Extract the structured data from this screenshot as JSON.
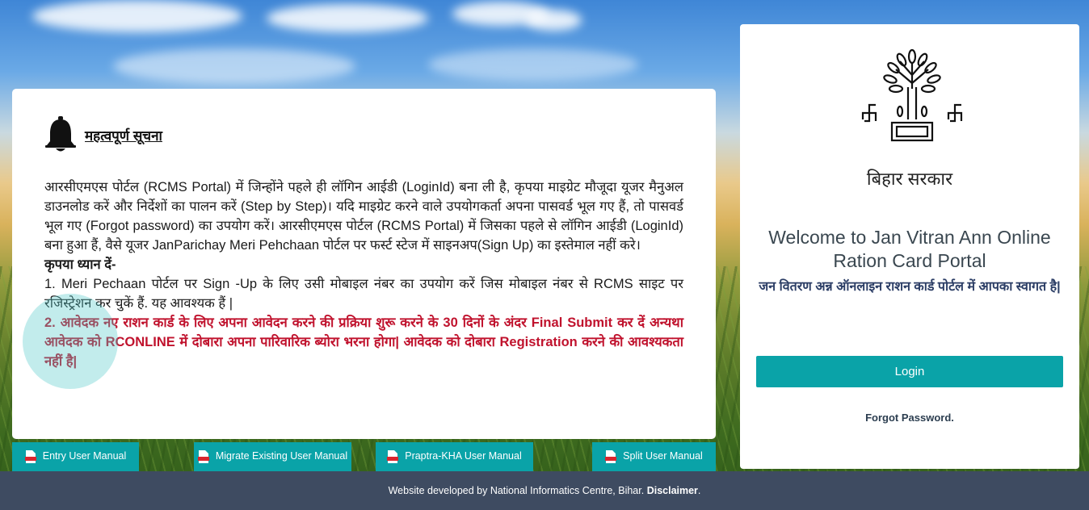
{
  "notice": {
    "title": "महत्वपूर्ण सूचना",
    "para1": "आरसीएमएस पोर्टल (RCMS Portal) में जिन्होंने पहले ही लॉगिन आईडी (LoginId) बना ली है, कृपया माइग्रेट मौजूदा यूजर मैनुअल डाउनलोड करें और निर्देशों का पालन करें (Step by Step)। यदि माइग्रेट करने वाले उपयोगकर्ता अपना पासवर्ड भूल गए हैं, तो पासवर्ड भूल गए (Forgot password) का उपयोग करें। आरसीएमएस पोर्टल (RCMS Portal) में जिसका पहले से लॉगिन आईडी (LoginId) बना हुआ हैं, वैसे यूजर JanParichay Meri Pehchaan पोर्टल पर फर्स्ट स्टेज में साइनअप(Sign Up) का इस्तेमाल नहीं करे।",
    "attention_label": "कृपया ध्यान दें-",
    "point1": "1. Meri Pechaan पोर्टल पर Sign -Up के लिए उसी मोबाइल नंबर का उपयोग करें जिस मोबाइल नंबर से RCMS साइट पर रजिस्ट्रेशन कर चुकें हैं. यह आवश्यक हैं |",
    "point2": "2. आवेदक नए राशन कार्ड के लिए अपना आवेदन करने की प्रक्रिया शुरू करने के 30 दिनों के अंदर Final Submit कर दें अन्यथा आवेदक को RCONLINE में दोबारा अपना पारिवारिक ब्योरा भरना होगा| आवेदक को दोबारा Registration करने की आवश्यकता नहीं है|"
  },
  "manuals": [
    {
      "label": "Entry User Manual"
    },
    {
      "label": "Migrate Existing User Manual"
    },
    {
      "label": "Praptra-KHA User Manual"
    },
    {
      "label": "Split User Manual"
    }
  ],
  "login": {
    "emblem_caption": "बिहार सरकार",
    "welcome_en": "Welcome to Jan Vitran Ann Online Ration Card Portal",
    "welcome_hi": "जन वितरण अन्न ऑनलाइन राशन कार्ड पोर्टल में आपका स्वागत है|",
    "login_button": "Login",
    "forgot_password": "Forgot Password."
  },
  "footer": {
    "text": "Website developed by National Informatics Centre, Bihar.",
    "disclaimer": "Disclaimer",
    "end": "."
  },
  "colors": {
    "accent": "#0aa3a8",
    "footer_bg": "#3e4b61",
    "notice_red": "#c0122d"
  }
}
